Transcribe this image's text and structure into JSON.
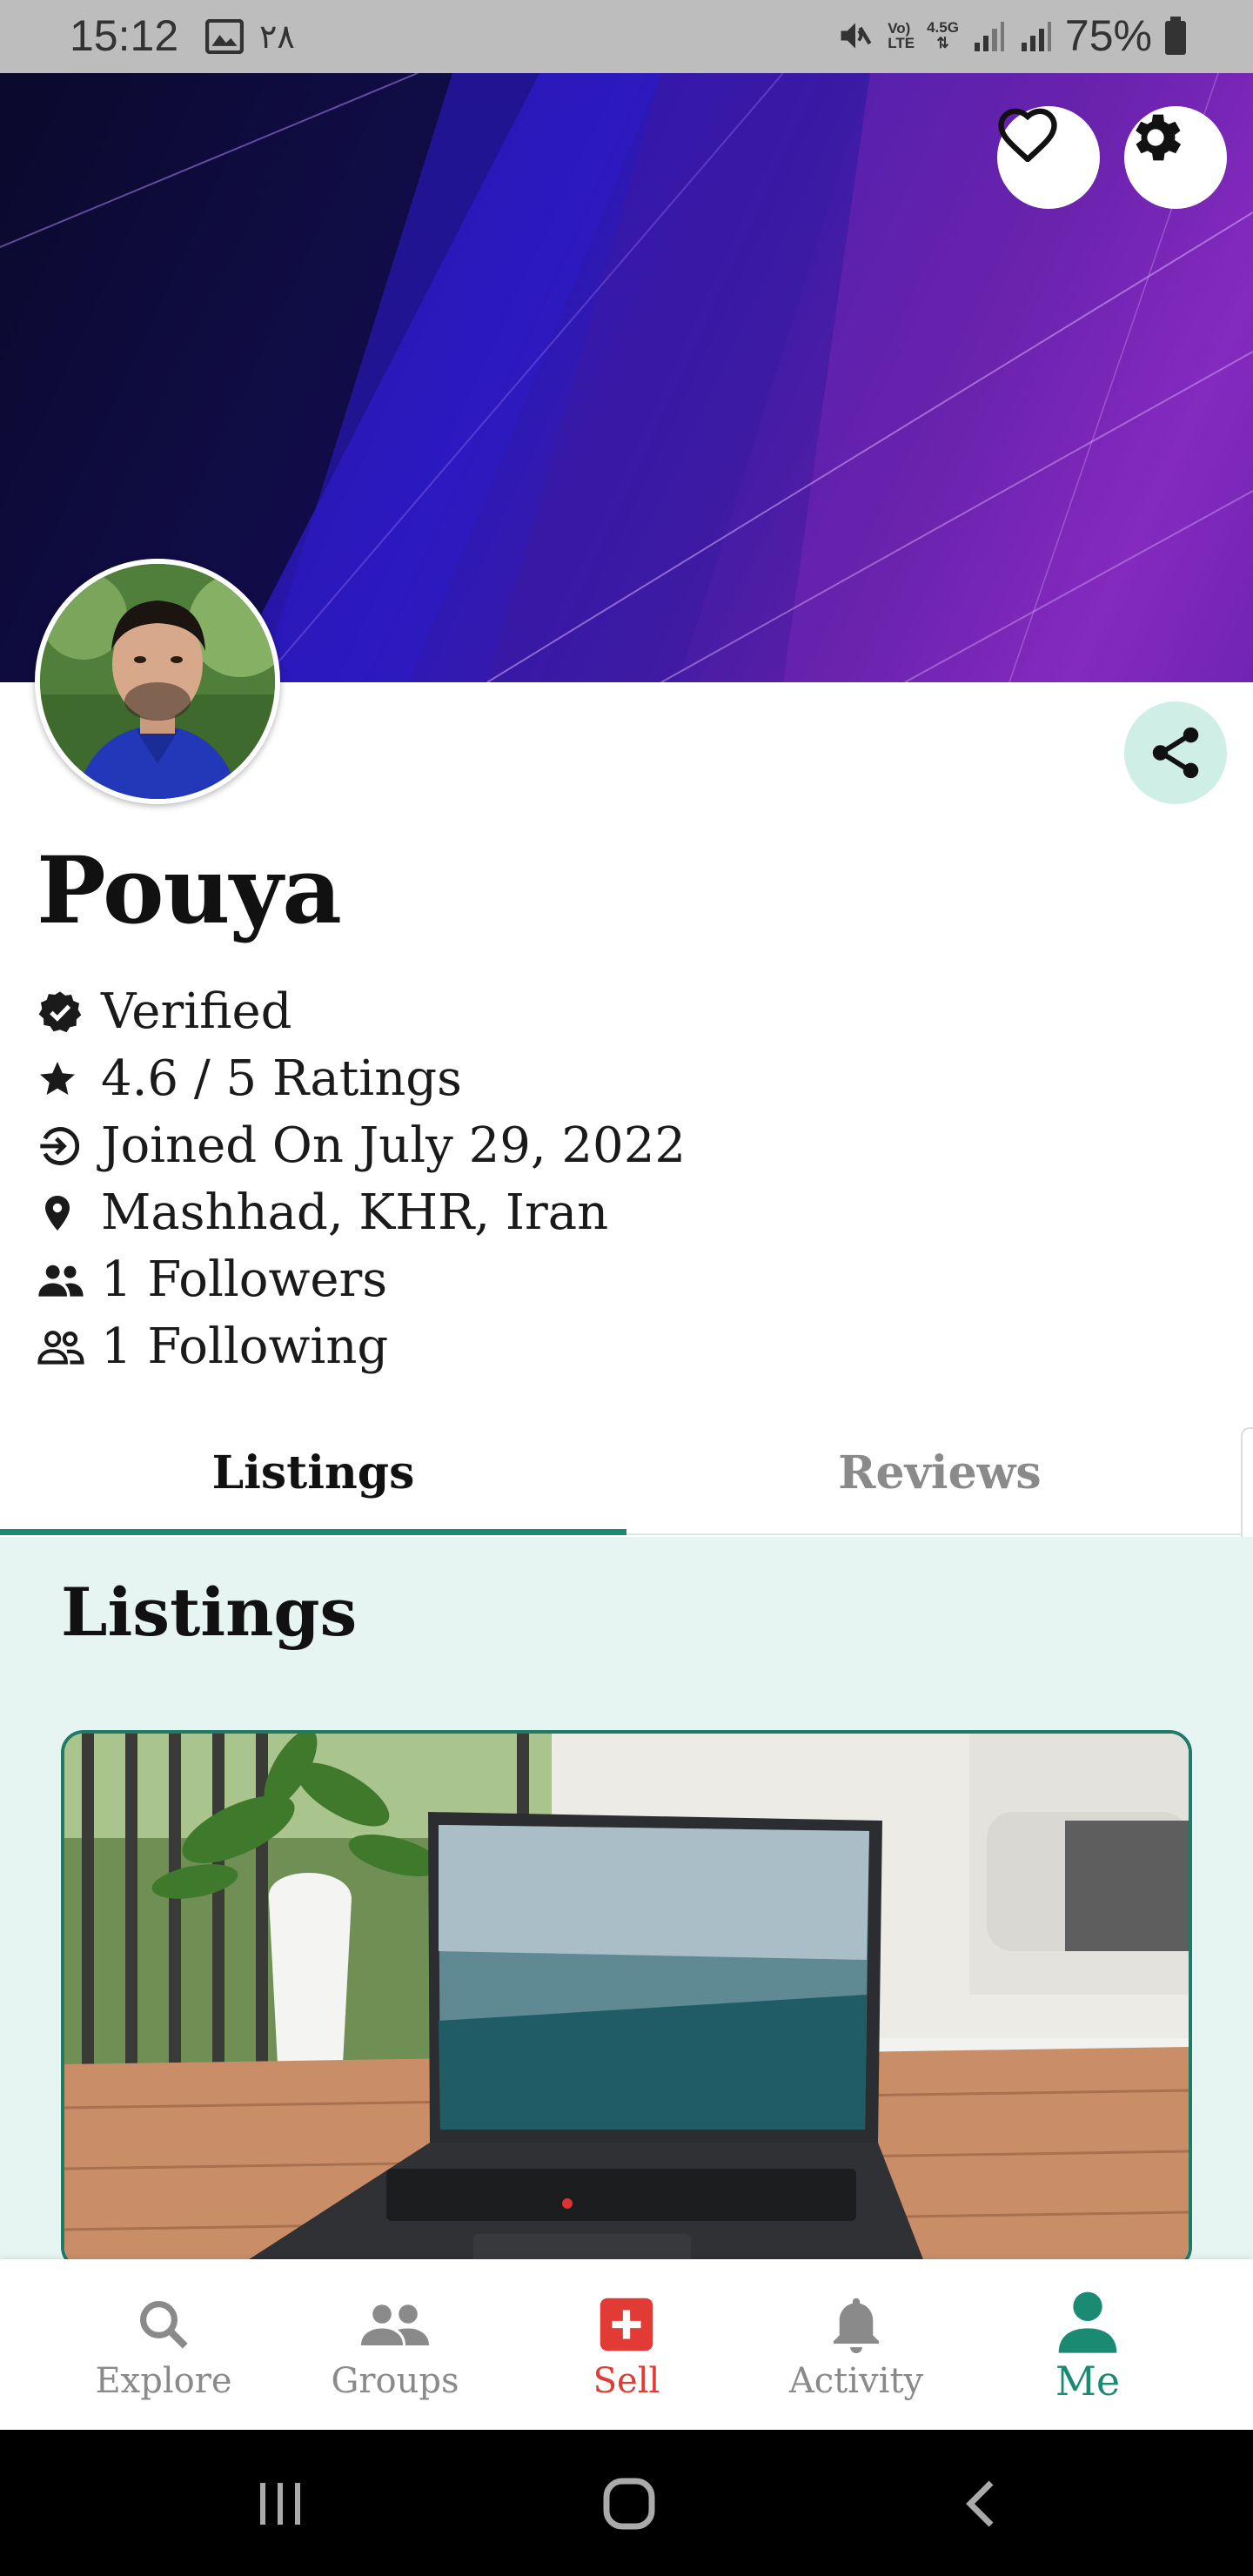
{
  "status_bar": {
    "time": "15:12",
    "notification_text": "۲۸",
    "network_label_1": "Vo)",
    "network_label_2": "LTE",
    "network_gen": "4.5G",
    "battery": "75%"
  },
  "profile": {
    "name": "Pouya",
    "verified": "Verified",
    "rating": "4.6 / 5 Ratings",
    "joined": "Joined On July 29, 2022",
    "location": "Mashhad, KHR, Iran",
    "followers": "1 Followers",
    "following": "1 Following"
  },
  "tabs": [
    {
      "label": "Listings",
      "active": true
    },
    {
      "label": "Reviews",
      "active": false
    }
  ],
  "listings": {
    "title": "Listings"
  },
  "bottom_nav": [
    {
      "label": "Explore",
      "icon": "search-icon"
    },
    {
      "label": "Groups",
      "icon": "groups-icon"
    },
    {
      "label": "Sell",
      "icon": "add-box-icon"
    },
    {
      "label": "Activity",
      "icon": "bell-icon"
    },
    {
      "label": "Me",
      "icon": "person-icon",
      "active": true
    }
  ],
  "colors": {
    "accent": "#1a8a72",
    "sell": "#e23a34",
    "listings_bg": "#e6f5f1",
    "share_bg": "#cfeee6"
  }
}
